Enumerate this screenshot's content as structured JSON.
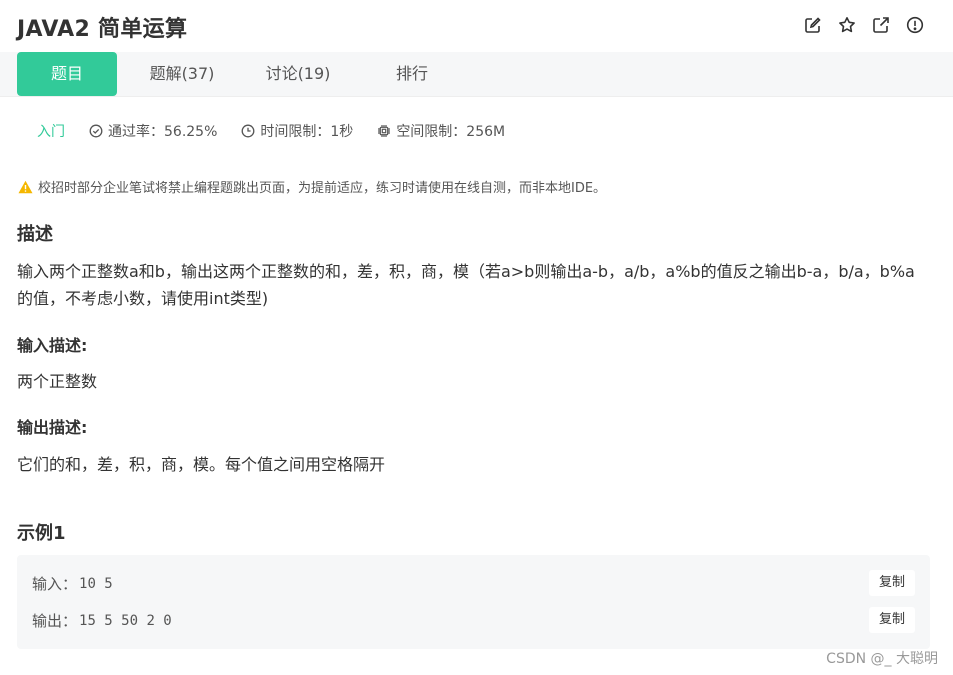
{
  "header": {
    "title": "JAVA2  简单运算",
    "icons": [
      "edit-icon",
      "star-icon",
      "share-icon",
      "report-icon"
    ]
  },
  "tabs": [
    {
      "label": "题目",
      "active": true
    },
    {
      "label": "题解(37)",
      "active": false
    },
    {
      "label": "讨论(19)",
      "active": false
    },
    {
      "label": "排行",
      "active": false
    }
  ],
  "meta": {
    "difficulty": "入门",
    "pass_rate": "通过率：56.25%",
    "time_limit": "时间限制：1秒",
    "memory_limit": "空间限制：256M"
  },
  "warning": "校招时部分企业笔试将禁止编程题跳出页面，为提前适应，练习时请使用在线自测，而非本地IDE。",
  "description": {
    "title": "描述",
    "text": "输入两个正整数a和b，输出这两个正整数的和，差，积，商，模（若a>b则输出a-b，a/b，a%b的值反之输出b-a，b/a，b%a的值，不考虑小数，请使用int类型)"
  },
  "input_desc": {
    "title": "输入描述:",
    "text": "两个正整数"
  },
  "output_desc": {
    "title": "输出描述:",
    "text": "它们的和，差，积，商，模。每个值之间用空格隔开"
  },
  "example": {
    "title": "示例1",
    "input_label": "输入：",
    "input_value": "10 5",
    "output_label": "输出：",
    "output_value": "15 5 50 2 0",
    "copy_label": "复制"
  },
  "watermark": "CSDN @_ 大聪明",
  "colors": {
    "accent": "#32ca99",
    "warning": "#f5b700"
  }
}
